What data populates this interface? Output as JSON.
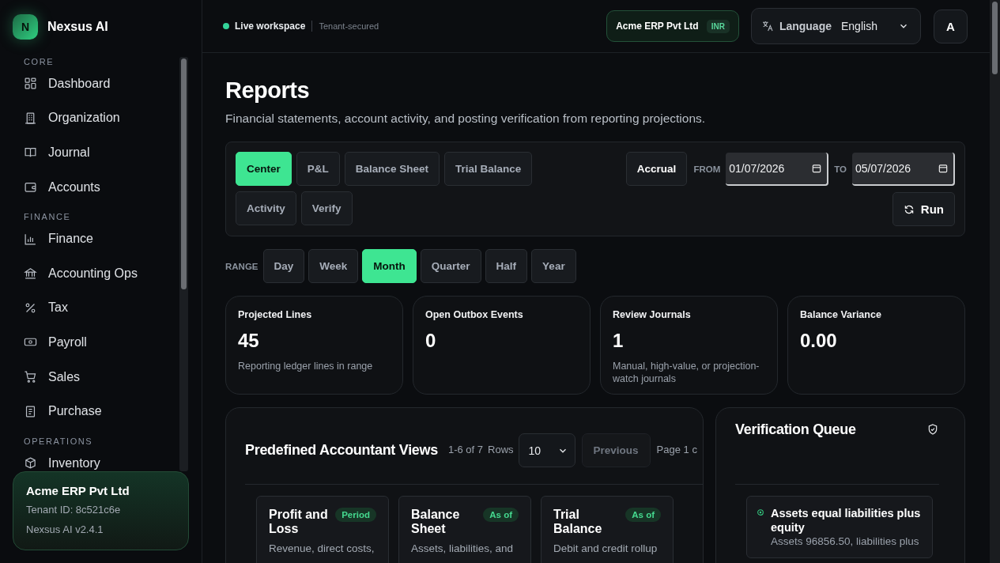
{
  "brand": {
    "initial": "N",
    "name": "Nexsus AI"
  },
  "sidebar": {
    "items": [
      {
        "kind": "section",
        "label": "CORE"
      },
      {
        "kind": "item",
        "label": "Dashboard"
      },
      {
        "kind": "item",
        "label": "Organization"
      },
      {
        "kind": "item",
        "label": "Journal"
      },
      {
        "kind": "item",
        "label": "Accounts"
      },
      {
        "kind": "section",
        "label": "FINANCE"
      },
      {
        "kind": "item",
        "label": "Finance"
      },
      {
        "kind": "item",
        "label": "Accounting Ops"
      },
      {
        "kind": "item",
        "label": "Tax"
      },
      {
        "kind": "item",
        "label": "Payroll"
      },
      {
        "kind": "item",
        "label": "Sales"
      },
      {
        "kind": "item",
        "label": "Purchase"
      },
      {
        "kind": "section",
        "label": "OPERATIONS"
      },
      {
        "kind": "item",
        "label": "Inventory"
      }
    ],
    "tenant": {
      "name": "Acme ERP Pvt Ltd",
      "id": "Tenant ID: 8c521c6e",
      "version": "Nexsus AI v2.4.1"
    }
  },
  "topbar": {
    "status": "Live workspace",
    "note": "Tenant-secured",
    "company": "Acme ERP Pvt Ltd",
    "currency": "INR",
    "language_label": "Language",
    "language": "English",
    "avatar": "A"
  },
  "page": {
    "title": "Reports",
    "subtitle": "Financial statements, account activity, and posting verification from reporting projections."
  },
  "tabs": [
    {
      "label": "Center",
      "selected": true
    },
    {
      "label": "P&L",
      "selected": false
    },
    {
      "label": "Balance Sheet",
      "selected": false
    },
    {
      "label": "Trial Balance",
      "selected": false
    },
    {
      "label": "Activity",
      "selected": false
    },
    {
      "label": "Verify",
      "selected": false
    }
  ],
  "basis": "Accrual",
  "from_label": "FROM",
  "from": "01/07/2026",
  "to_label": "TO",
  "to": "05/07/2026",
  "run": "Run",
  "range": {
    "label": "RANGE",
    "options": [
      {
        "label": "Day",
        "selected": false
      },
      {
        "label": "Week",
        "selected": false
      },
      {
        "label": "Month",
        "selected": true
      },
      {
        "label": "Quarter",
        "selected": false
      },
      {
        "label": "Half",
        "selected": false
      },
      {
        "label": "Year",
        "selected": false
      }
    ]
  },
  "metrics": [
    {
      "title": "Projected Lines",
      "value": "45",
      "note": "Reporting ledger lines in range"
    },
    {
      "title": "Open Outbox Events",
      "value": "0"
    },
    {
      "title": "Review Journals",
      "value": "1",
      "note": "Manual, high-value, or projection-watch journals"
    },
    {
      "title": "Balance Variance",
      "value": "0.00"
    }
  ],
  "views": {
    "title": "Predefined Accountant Views",
    "count": "1-6 of 7",
    "rows_label": "Rows",
    "rows": "10",
    "previous": "Previous",
    "page": "Page 1 c",
    "cards": [
      {
        "title": "Profit and Loss",
        "badge": "Period",
        "desc": "Revenue, direct costs,"
      },
      {
        "title": "Balance Sheet",
        "badge": "As of",
        "desc": "Assets, liabilities, and"
      },
      {
        "title": "Trial Balance",
        "badge": "As of",
        "desc": "Debit and credit rollup"
      }
    ]
  },
  "queue": {
    "title": "Verification Queue",
    "items": [
      {
        "title": "Assets equal liabilities plus equity",
        "desc": "Assets 96856.50, liabilities plus",
        "passed": true
      }
    ]
  }
}
